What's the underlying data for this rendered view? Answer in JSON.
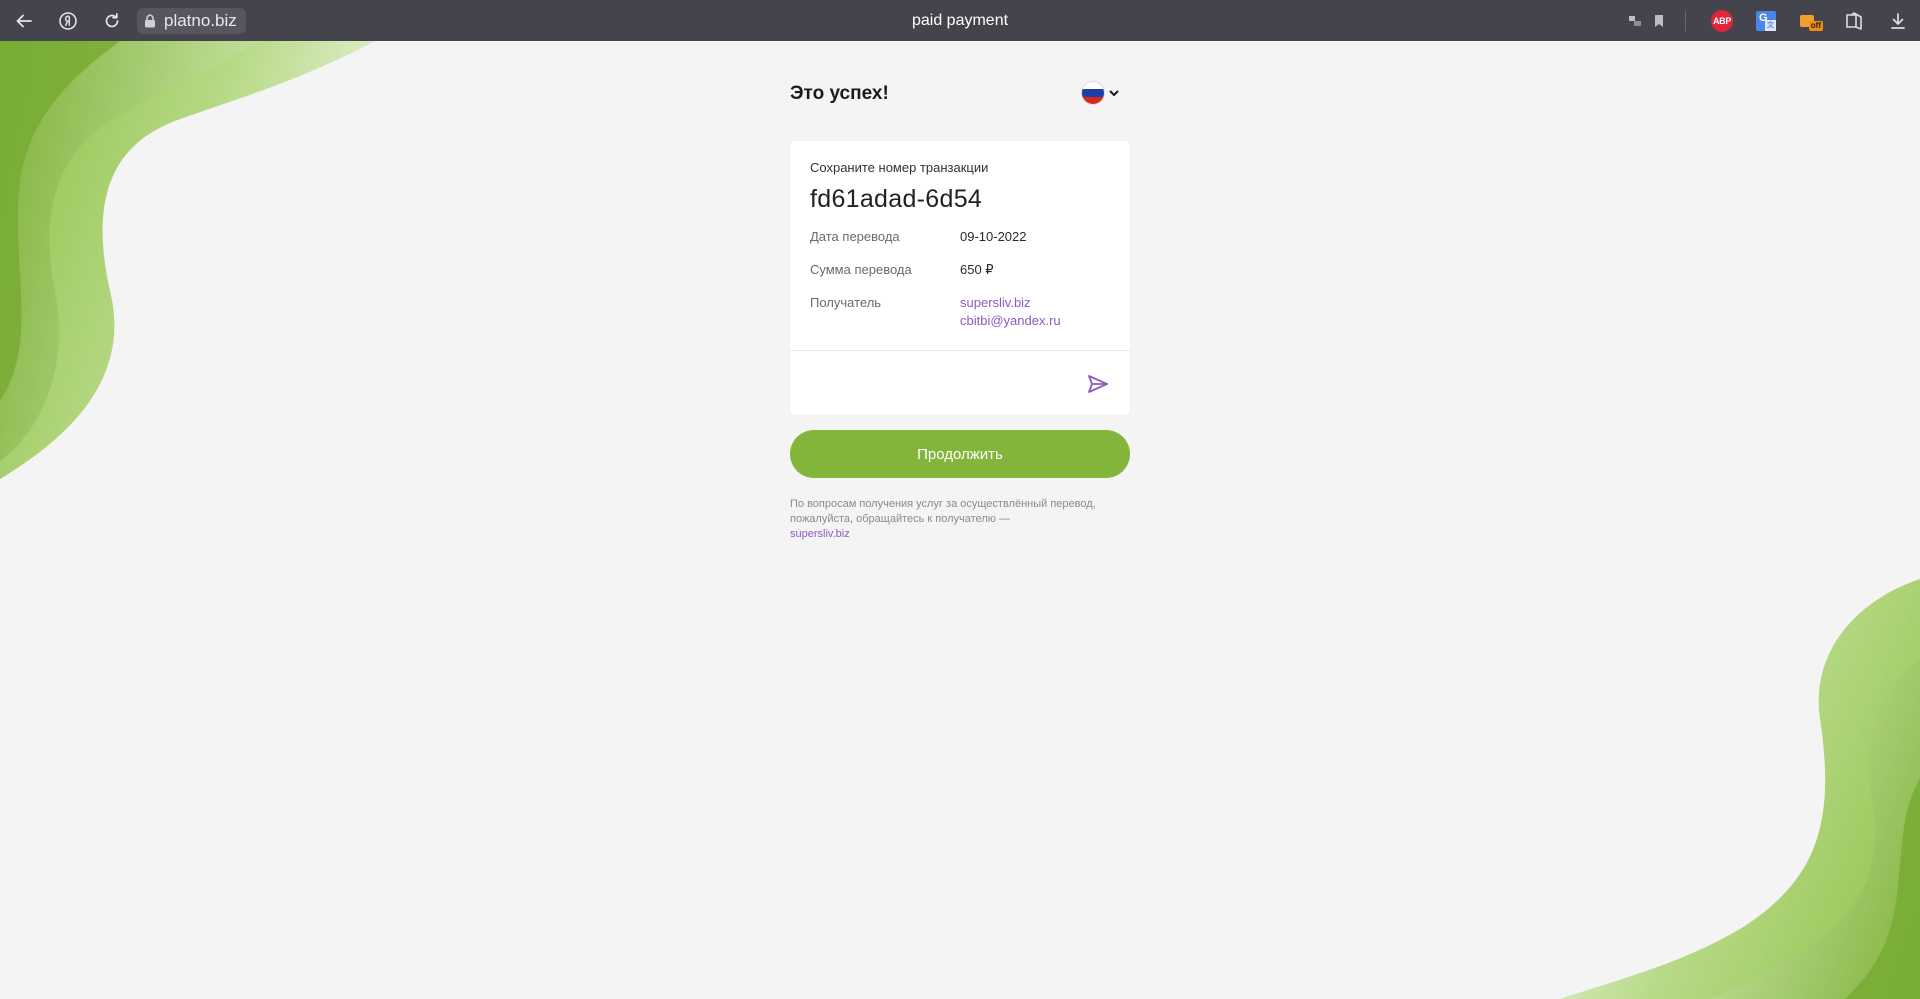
{
  "browser": {
    "url": "platno.biz",
    "tab_title": "paid payment"
  },
  "page": {
    "title": "Это успех!",
    "language": "ru",
    "card": {
      "caption": "Сохраните номер транзакции",
      "transaction_id": "fd61adad-6d54",
      "date_label": "Дата перевода",
      "date_value": "09-10-2022",
      "amount_label": "Сумма перевода",
      "amount_value": "650 ₽",
      "recipient_label": "Получатель",
      "recipient_site": "supersliv.biz",
      "recipient_email": "cbitbi@yandex.ru"
    },
    "continue_label": "Продолжить",
    "footnote_text": "По вопросам получения услуг за осуществлённый перевод, пожалуйста, обращайтесь к получателю —",
    "footnote_link": "supersliv.biz"
  },
  "colors": {
    "accent_green": "#82b539",
    "link_purple": "#8a5cc0",
    "chrome_bg": "#44444c"
  }
}
